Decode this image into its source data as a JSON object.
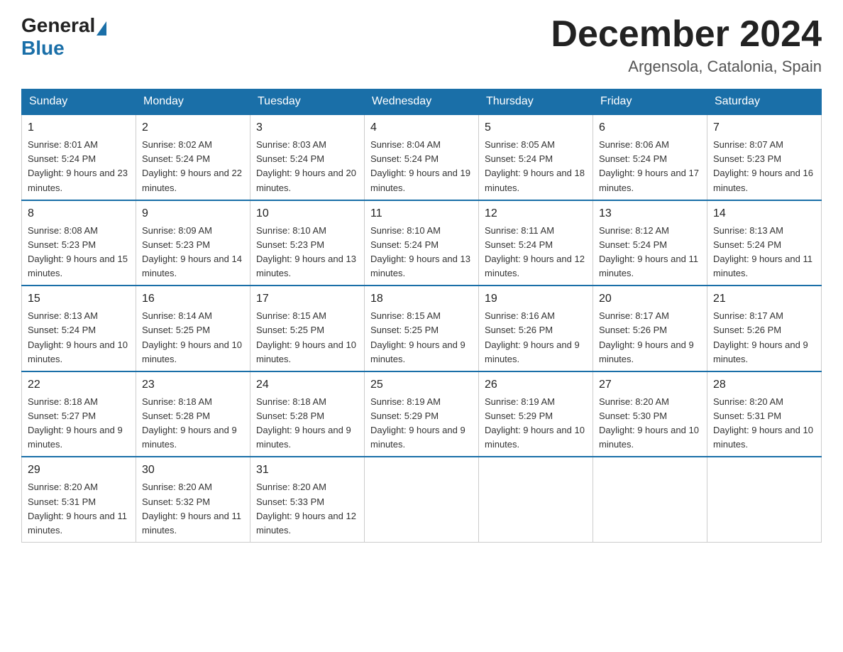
{
  "logo": {
    "general": "General",
    "blue": "Blue"
  },
  "title": {
    "month_year": "December 2024",
    "location": "Argensola, Catalonia, Spain"
  },
  "headers": [
    "Sunday",
    "Monday",
    "Tuesday",
    "Wednesday",
    "Thursday",
    "Friday",
    "Saturday"
  ],
  "weeks": [
    [
      {
        "day": "1",
        "sunrise": "8:01 AM",
        "sunset": "5:24 PM",
        "daylight": "9 hours and 23 minutes."
      },
      {
        "day": "2",
        "sunrise": "8:02 AM",
        "sunset": "5:24 PM",
        "daylight": "9 hours and 22 minutes."
      },
      {
        "day": "3",
        "sunrise": "8:03 AM",
        "sunset": "5:24 PM",
        "daylight": "9 hours and 20 minutes."
      },
      {
        "day": "4",
        "sunrise": "8:04 AM",
        "sunset": "5:24 PM",
        "daylight": "9 hours and 19 minutes."
      },
      {
        "day": "5",
        "sunrise": "8:05 AM",
        "sunset": "5:24 PM",
        "daylight": "9 hours and 18 minutes."
      },
      {
        "day": "6",
        "sunrise": "8:06 AM",
        "sunset": "5:24 PM",
        "daylight": "9 hours and 17 minutes."
      },
      {
        "day": "7",
        "sunrise": "8:07 AM",
        "sunset": "5:23 PM",
        "daylight": "9 hours and 16 minutes."
      }
    ],
    [
      {
        "day": "8",
        "sunrise": "8:08 AM",
        "sunset": "5:23 PM",
        "daylight": "9 hours and 15 minutes."
      },
      {
        "day": "9",
        "sunrise": "8:09 AM",
        "sunset": "5:23 PM",
        "daylight": "9 hours and 14 minutes."
      },
      {
        "day": "10",
        "sunrise": "8:10 AM",
        "sunset": "5:23 PM",
        "daylight": "9 hours and 13 minutes."
      },
      {
        "day": "11",
        "sunrise": "8:10 AM",
        "sunset": "5:24 PM",
        "daylight": "9 hours and 13 minutes."
      },
      {
        "day": "12",
        "sunrise": "8:11 AM",
        "sunset": "5:24 PM",
        "daylight": "9 hours and 12 minutes."
      },
      {
        "day": "13",
        "sunrise": "8:12 AM",
        "sunset": "5:24 PM",
        "daylight": "9 hours and 11 minutes."
      },
      {
        "day": "14",
        "sunrise": "8:13 AM",
        "sunset": "5:24 PM",
        "daylight": "9 hours and 11 minutes."
      }
    ],
    [
      {
        "day": "15",
        "sunrise": "8:13 AM",
        "sunset": "5:24 PM",
        "daylight": "9 hours and 10 minutes."
      },
      {
        "day": "16",
        "sunrise": "8:14 AM",
        "sunset": "5:25 PM",
        "daylight": "9 hours and 10 minutes."
      },
      {
        "day": "17",
        "sunrise": "8:15 AM",
        "sunset": "5:25 PM",
        "daylight": "9 hours and 10 minutes."
      },
      {
        "day": "18",
        "sunrise": "8:15 AM",
        "sunset": "5:25 PM",
        "daylight": "9 hours and 9 minutes."
      },
      {
        "day": "19",
        "sunrise": "8:16 AM",
        "sunset": "5:26 PM",
        "daylight": "9 hours and 9 minutes."
      },
      {
        "day": "20",
        "sunrise": "8:17 AM",
        "sunset": "5:26 PM",
        "daylight": "9 hours and 9 minutes."
      },
      {
        "day": "21",
        "sunrise": "8:17 AM",
        "sunset": "5:26 PM",
        "daylight": "9 hours and 9 minutes."
      }
    ],
    [
      {
        "day": "22",
        "sunrise": "8:18 AM",
        "sunset": "5:27 PM",
        "daylight": "9 hours and 9 minutes."
      },
      {
        "day": "23",
        "sunrise": "8:18 AM",
        "sunset": "5:28 PM",
        "daylight": "9 hours and 9 minutes."
      },
      {
        "day": "24",
        "sunrise": "8:18 AM",
        "sunset": "5:28 PM",
        "daylight": "9 hours and 9 minutes."
      },
      {
        "day": "25",
        "sunrise": "8:19 AM",
        "sunset": "5:29 PM",
        "daylight": "9 hours and 9 minutes."
      },
      {
        "day": "26",
        "sunrise": "8:19 AM",
        "sunset": "5:29 PM",
        "daylight": "9 hours and 10 minutes."
      },
      {
        "day": "27",
        "sunrise": "8:20 AM",
        "sunset": "5:30 PM",
        "daylight": "9 hours and 10 minutes."
      },
      {
        "day": "28",
        "sunrise": "8:20 AM",
        "sunset": "5:31 PM",
        "daylight": "9 hours and 10 minutes."
      }
    ],
    [
      {
        "day": "29",
        "sunrise": "8:20 AM",
        "sunset": "5:31 PM",
        "daylight": "9 hours and 11 minutes."
      },
      {
        "day": "30",
        "sunrise": "8:20 AM",
        "sunset": "5:32 PM",
        "daylight": "9 hours and 11 minutes."
      },
      {
        "day": "31",
        "sunrise": "8:20 AM",
        "sunset": "5:33 PM",
        "daylight": "9 hours and 12 minutes."
      },
      null,
      null,
      null,
      null
    ]
  ]
}
